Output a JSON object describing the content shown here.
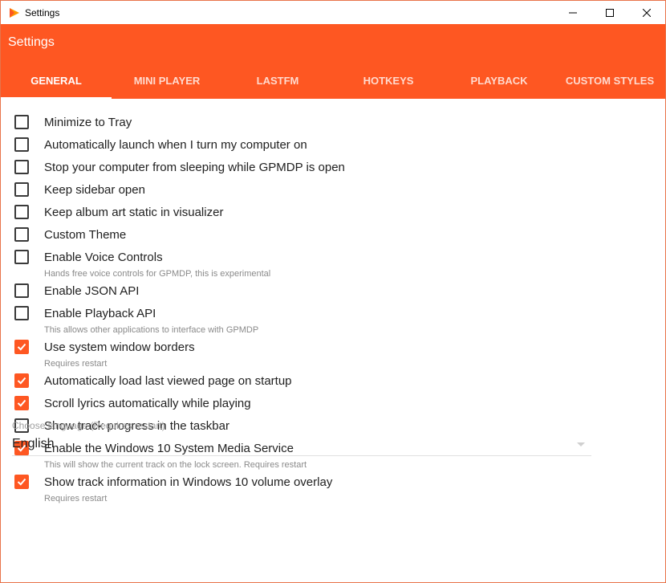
{
  "window": {
    "title": "Settings"
  },
  "header": {
    "title": "Settings"
  },
  "tabs": [
    {
      "label": "GENERAL",
      "active": true
    },
    {
      "label": "MINI PLAYER",
      "active": false
    },
    {
      "label": "LASTFM",
      "active": false
    },
    {
      "label": "HOTKEYS",
      "active": false
    },
    {
      "label": "PLAYBACK",
      "active": false
    },
    {
      "label": "CUSTOM STYLES",
      "active": false
    }
  ],
  "options": [
    {
      "label": "Minimize to Tray",
      "checked": false,
      "sub": ""
    },
    {
      "label": "Automatically launch when I turn my computer on",
      "checked": false,
      "sub": ""
    },
    {
      "label": "Stop your computer from sleeping while GPMDP is open",
      "checked": false,
      "sub": ""
    },
    {
      "label": "Keep sidebar open",
      "checked": false,
      "sub": ""
    },
    {
      "label": "Keep album art static in visualizer",
      "checked": false,
      "sub": ""
    },
    {
      "label": "Custom Theme",
      "checked": false,
      "sub": ""
    },
    {
      "label": "Enable Voice Controls",
      "checked": false,
      "sub": "Hands free voice controls for GPMDP, this is experimental"
    },
    {
      "label": "Enable JSON API",
      "checked": false,
      "sub": ""
    },
    {
      "label": "Enable Playback API",
      "checked": false,
      "sub": "This allows other applications to interface with GPMDP"
    },
    {
      "label": "Use system window borders",
      "checked": true,
      "sub": "Requires restart"
    },
    {
      "label": "Automatically load last viewed page on startup",
      "checked": true,
      "sub": ""
    },
    {
      "label": "Scroll lyrics automatically while playing",
      "checked": true,
      "sub": ""
    },
    {
      "label": "Show track progress in the taskbar",
      "checked": false,
      "sub": ""
    },
    {
      "label": "Enable the Windows 10 System Media Service",
      "checked": true,
      "sub": "This will show the current track on the lock screen. Requires restart"
    },
    {
      "label": "Show track information in Windows 10 volume overlay",
      "checked": true,
      "sub": "Requires restart"
    }
  ],
  "language": {
    "label": "Choose language (Requires restart)",
    "value": "English"
  },
  "colors": {
    "accent": "#fe5722",
    "window_border": "#e8734a"
  },
  "icons": {
    "app": "play-logo-icon",
    "minimize": "minimize-icon",
    "maximize": "maximize-icon",
    "close": "close-icon",
    "dropdown": "chevron-down-icon"
  }
}
